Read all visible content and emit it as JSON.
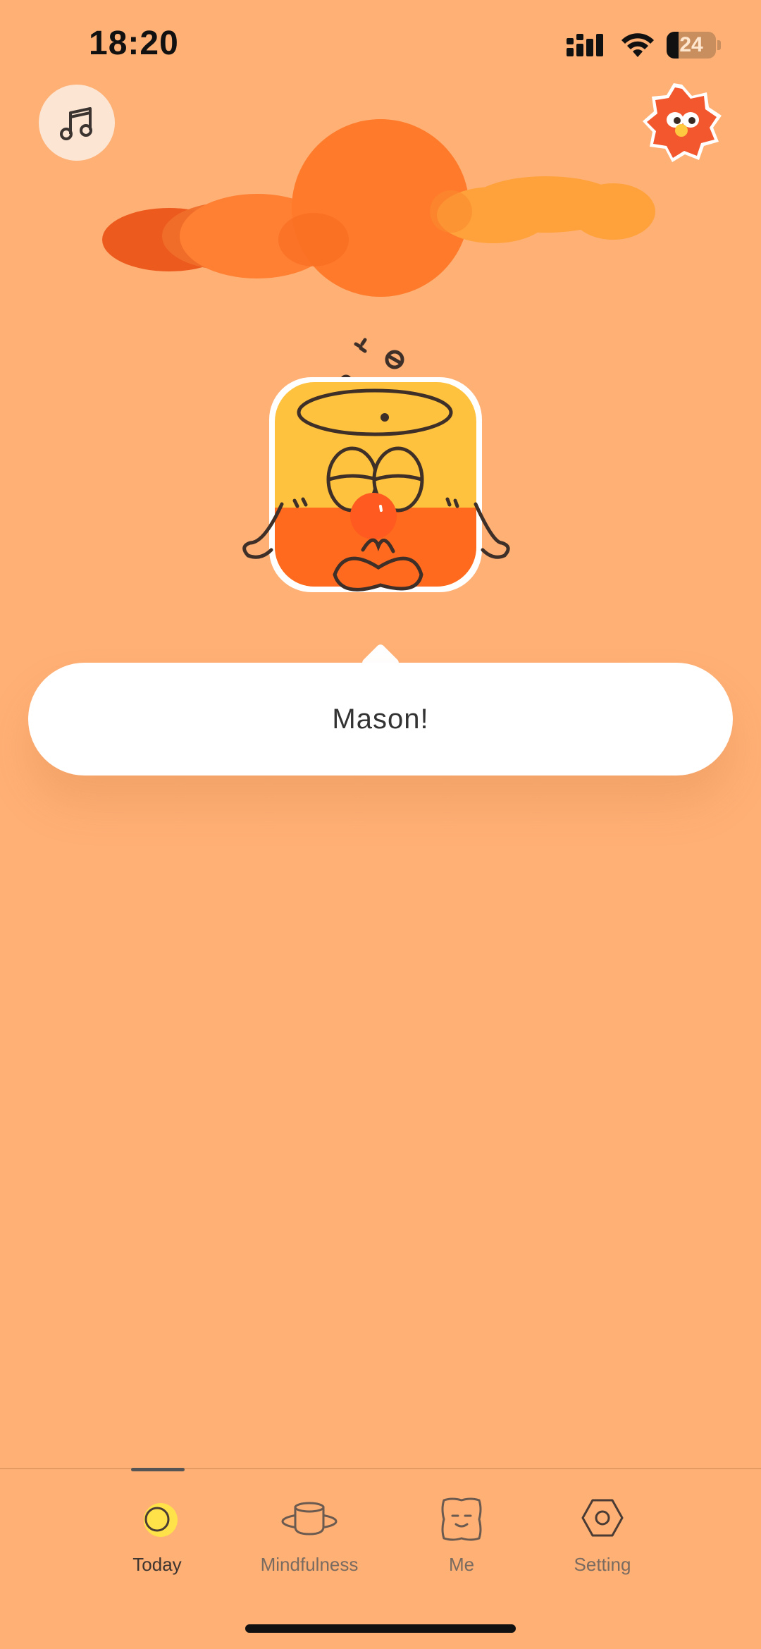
{
  "status_bar": {
    "time": "18:20",
    "battery_percent": 24,
    "battery_label": "24"
  },
  "header": {
    "music_icon": "music-note-icon",
    "avatar_icon": "flower-avatar-icon"
  },
  "speech_bubble": {
    "text": "Mason!"
  },
  "tab_bar": {
    "tabs": [
      {
        "label": "Today",
        "icon": "sun-icon",
        "active": true
      },
      {
        "label": "Mindfulness",
        "icon": "planet-icon",
        "active": false
      },
      {
        "label": "Me",
        "icon": "face-icon",
        "active": false
      },
      {
        "label": "Setting",
        "icon": "hex-nut-icon",
        "active": false
      }
    ]
  },
  "colors": {
    "background": "#FFB075",
    "sun": "#FF7B2B",
    "mascot_body": "#FFC23E",
    "accent_red": "#F2572E"
  }
}
